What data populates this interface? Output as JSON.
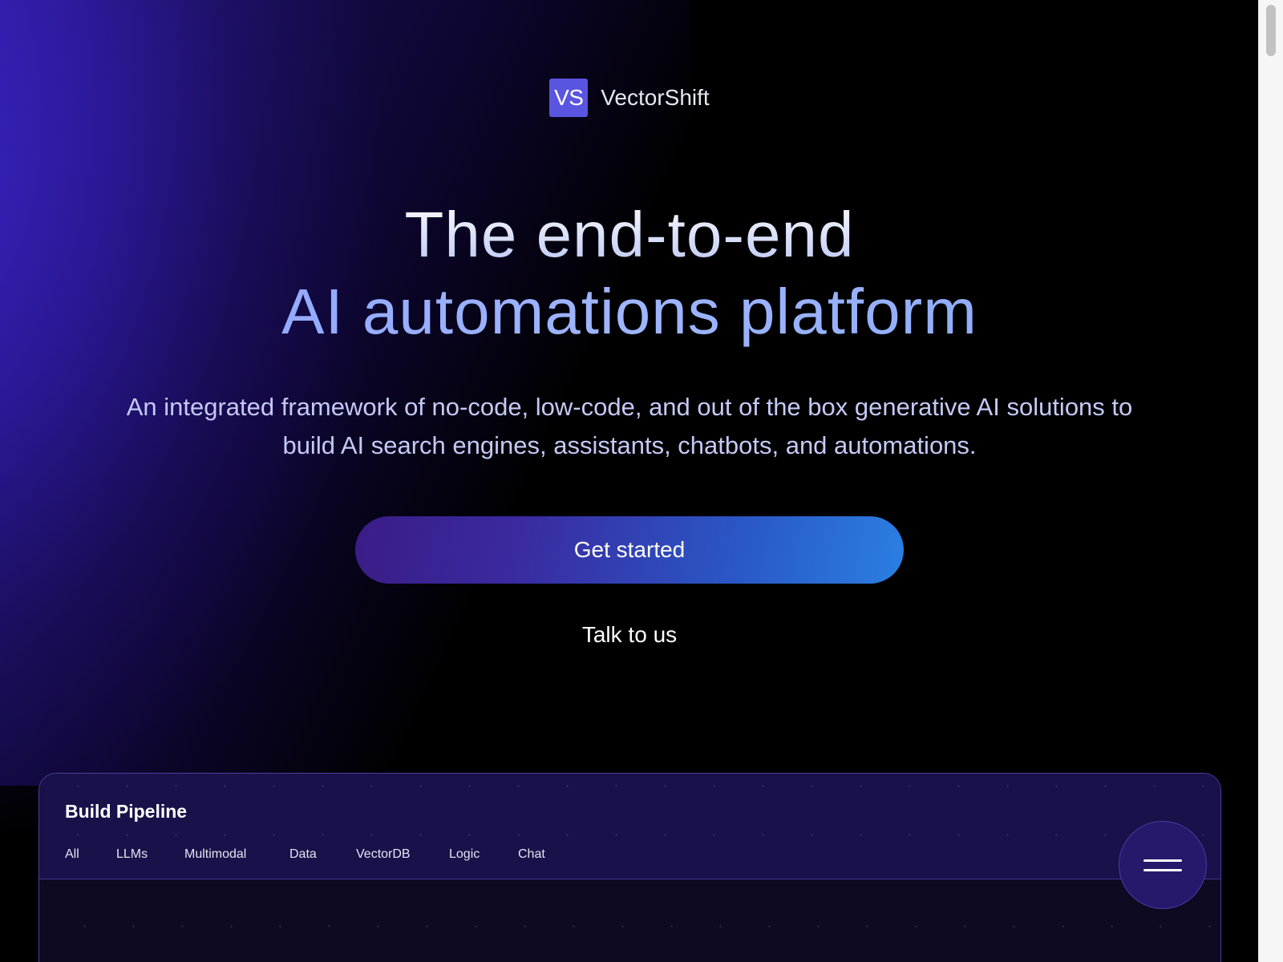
{
  "brand": {
    "logo_mark": "VS",
    "name": "VectorShift",
    "accent_color": "#5a55e0"
  },
  "hero": {
    "title_line1": "The end-to-end",
    "title_line2": "AI automations platform",
    "subtitle": "An integrated framework of no-code, low-code, and out of the box generative AI solutions to build AI search engines, assistants, chatbots, and automations."
  },
  "actions": {
    "primary_label": "Get started",
    "secondary_label": "Talk to us"
  },
  "pipeline": {
    "title": "Build Pipeline",
    "tabs": [
      "All",
      "LLMs",
      "Multimodal",
      "Data",
      "VectorDB",
      "Logic",
      "Chat"
    ],
    "menu_icon": "hamburger-menu-icon"
  }
}
